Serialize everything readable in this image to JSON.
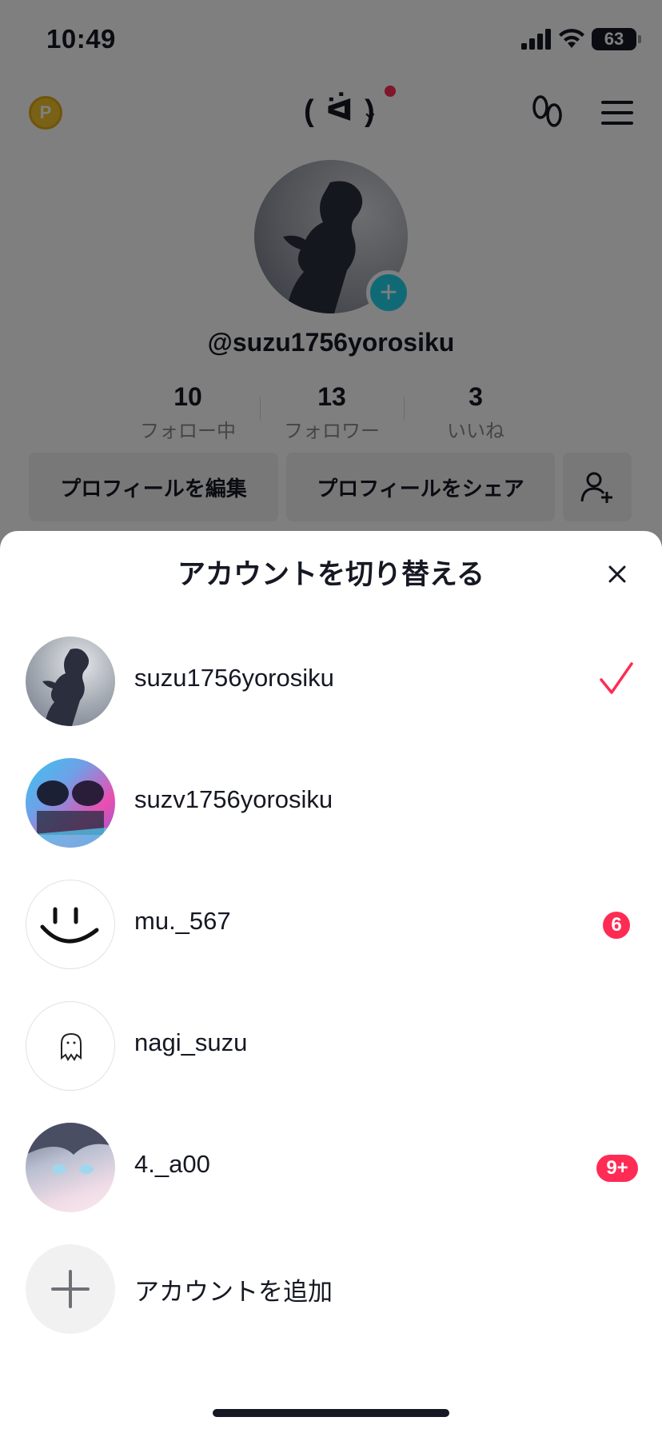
{
  "status_bar": {
    "time": "10:49",
    "battery": "63"
  },
  "profile": {
    "nav_title": "( ᐛ )",
    "handle": "@suzu1756yorosiku",
    "stats": [
      {
        "value": "10",
        "label": "フォロー中"
      },
      {
        "value": "13",
        "label": "フォロワー"
      },
      {
        "value": "3",
        "label": "いいね"
      }
    ],
    "buttons": {
      "edit": "プロフィールを編集",
      "share": "プロフィールをシェア"
    }
  },
  "sheet": {
    "title": "アカウントを切り替える",
    "accounts": [
      {
        "name": "suzu1756yorosiku",
        "selected": true
      },
      {
        "name": "suzv1756yorosiku"
      },
      {
        "name": "mu._567",
        "badge": "6"
      },
      {
        "name": "nagi_suzu"
      },
      {
        "name": "4._a00",
        "badge": "9+"
      }
    ],
    "add_account": "アカウントを追加"
  },
  "colors": {
    "accent": "#fe2c55",
    "teal": "#20d5ec",
    "overlay": "rgba(0,0,0,0.5)"
  }
}
